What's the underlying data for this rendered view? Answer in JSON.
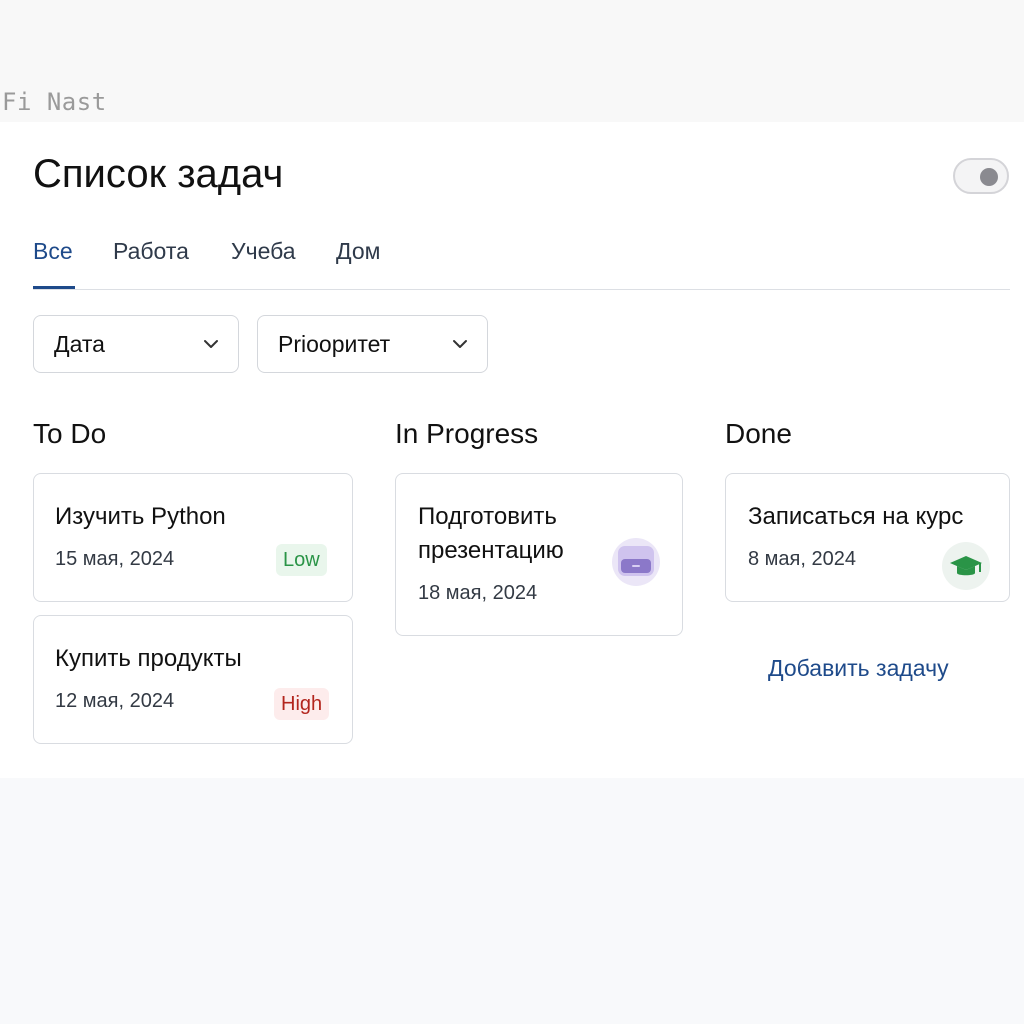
{
  "topbar": {
    "text": "Fi Nast"
  },
  "header": {
    "title": "Список задач",
    "toggle_on": false
  },
  "tabs": [
    {
      "label": "Все",
      "active": true
    },
    {
      "label": "Работа",
      "active": false
    },
    {
      "label": "Учеба",
      "active": false
    },
    {
      "label": "Дом",
      "active": false
    }
  ],
  "filters": {
    "date_label": "Дата",
    "priority_label": "Prioоритет"
  },
  "columns": {
    "todo": {
      "title": "To Do",
      "cards": [
        {
          "title": "Изучить Python",
          "date": "15 мая, 2024",
          "badge": "Low"
        },
        {
          "title": "Купить продукты",
          "date": "12 мая, 2024",
          "badge": "High"
        }
      ]
    },
    "in_progress": {
      "title": "In Progress",
      "cards": [
        {
          "title": "Подготовить презентацию",
          "date": "18 мая, 2024",
          "icon": "presentation-icon"
        }
      ]
    },
    "done": {
      "title": "Done",
      "cards": [
        {
          "title": "Записаться на курс",
          "date": "8 мая, 2024",
          "icon": "graduation-cap-icon"
        }
      ],
      "add_label": "Добавить задачу"
    }
  },
  "colors": {
    "accent": "#1e4a8a",
    "low_badge_text": "#2a9447",
    "low_badge_bg": "#e9f6ec",
    "high_badge_text": "#b3261e",
    "high_badge_bg": "#fdecec",
    "presentation_icon": "#8b78c9",
    "graduation_icon": "#2a9447"
  }
}
